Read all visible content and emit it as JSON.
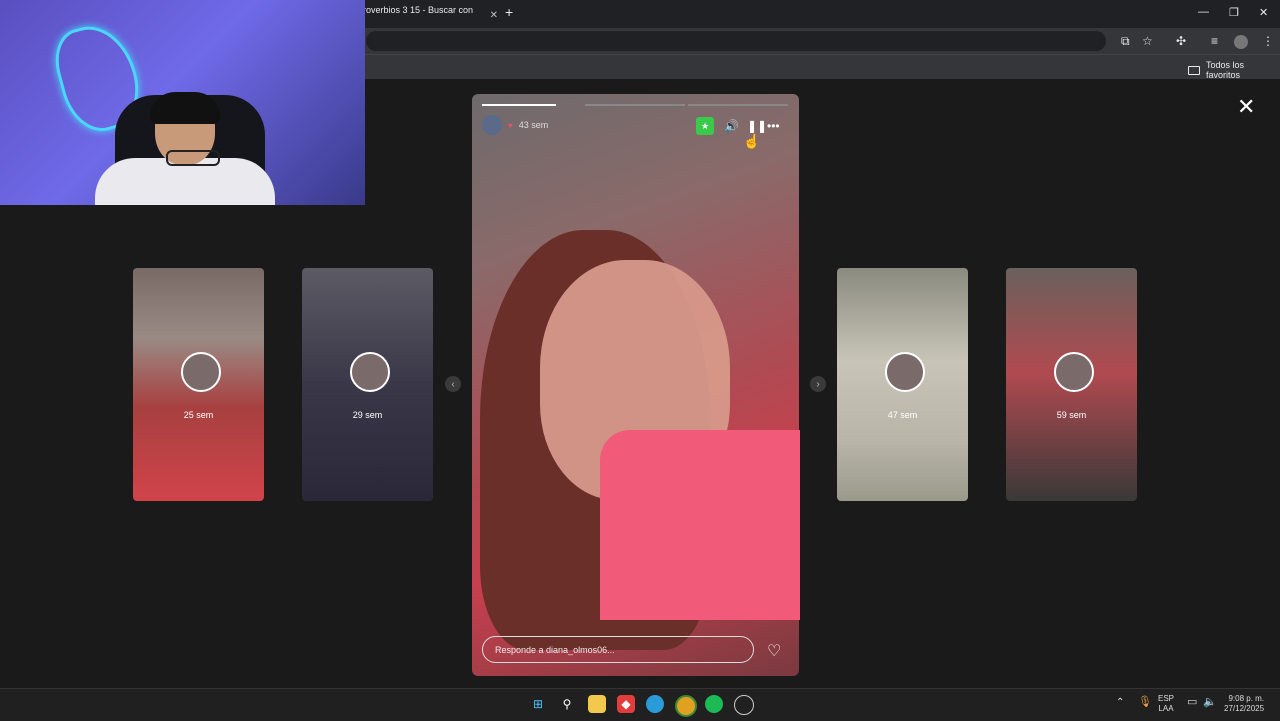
{
  "browser": {
    "tab_title": "proverbios 3 15 - Buscar con G",
    "tab_close": "✕",
    "new_tab": "+",
    "bookmark_folder": "Todos los favoritos",
    "win_min": "—",
    "win_max": "❐",
    "win_close": "✕"
  },
  "story": {
    "time": "43 sem",
    "reply_placeholder": "Responde a diana_olmos06...",
    "close": "✕",
    "progress": [
      1,
      0,
      0
    ]
  },
  "side_stories": [
    {
      "label": "25 sem"
    },
    {
      "label": "29 sem"
    },
    {
      "label": "47 sem"
    },
    {
      "label": "59 sem"
    }
  ],
  "taskbar": {
    "lang_top": "ESP",
    "lang_bottom": "LAA",
    "time": "9:08 p. m.",
    "date": "27/12/2025"
  }
}
